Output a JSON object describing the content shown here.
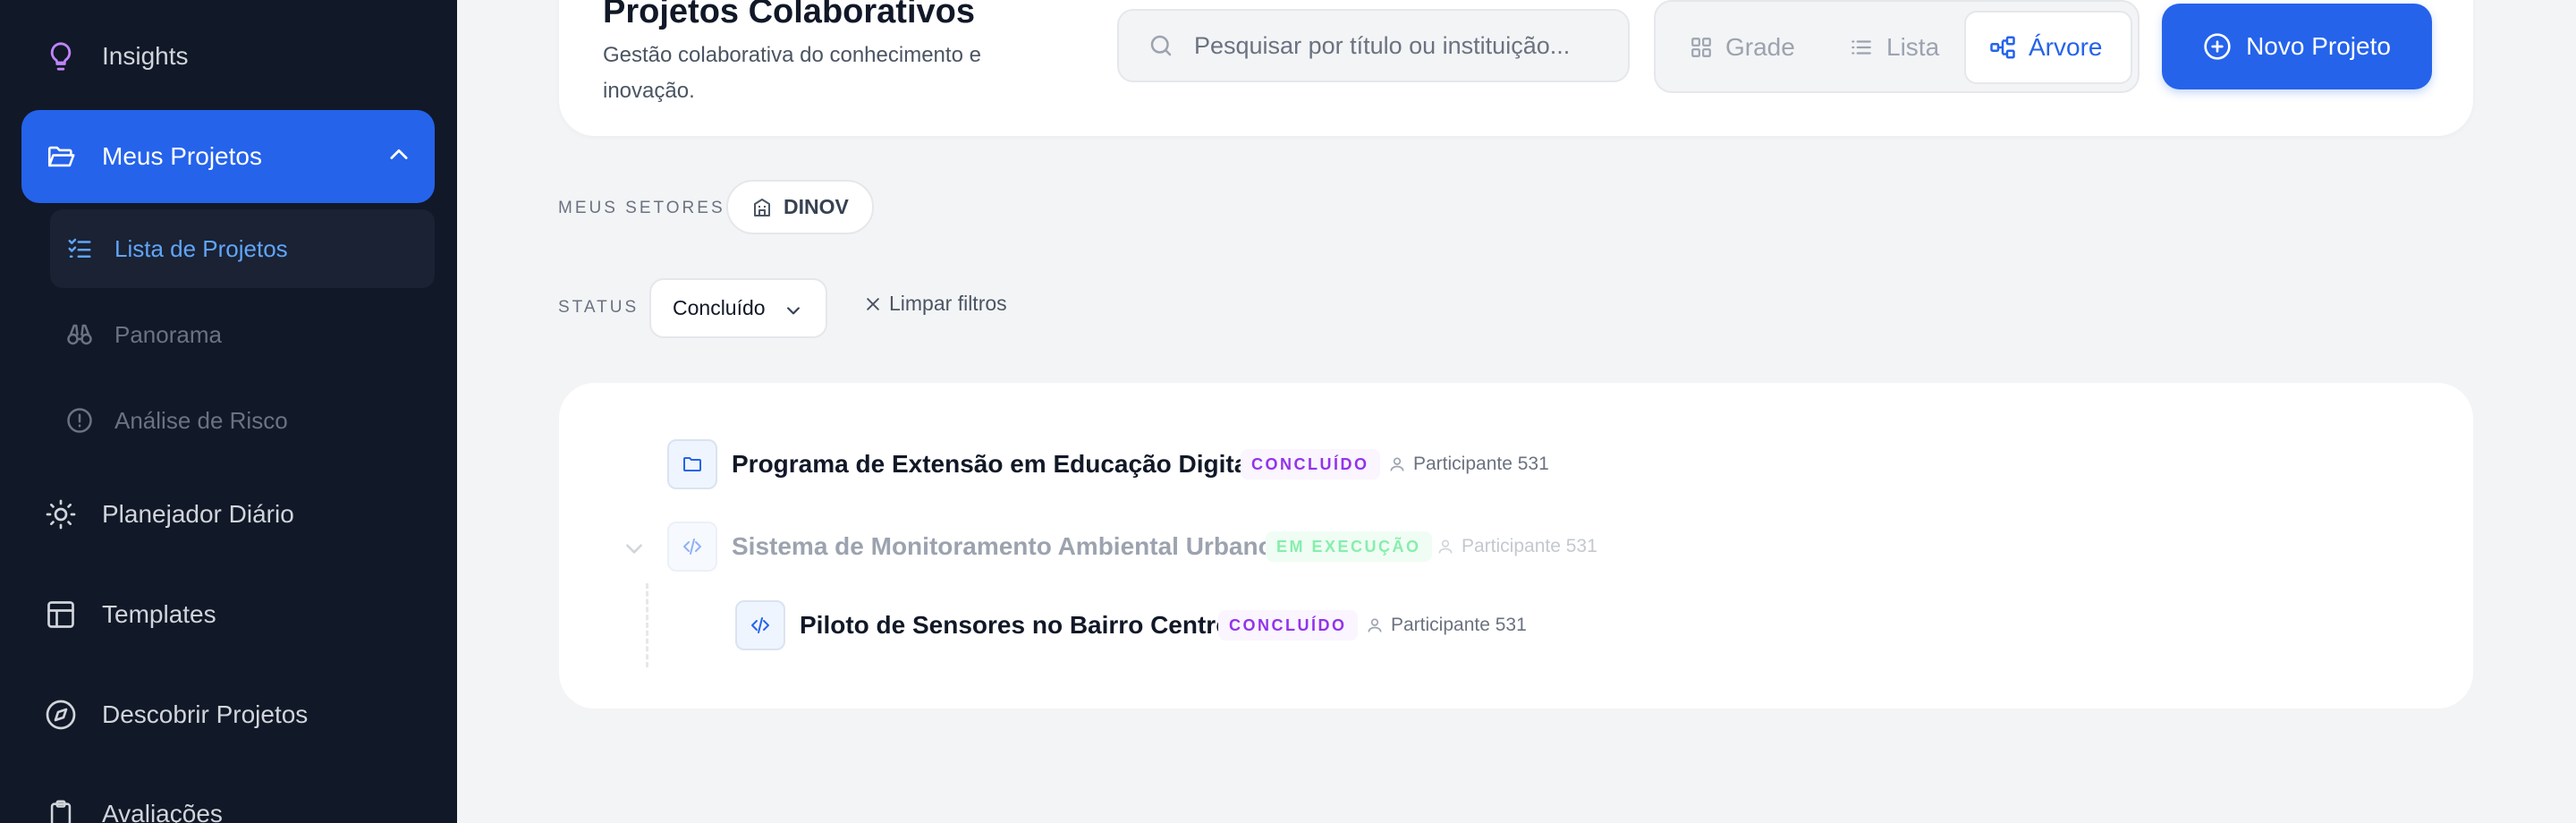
{
  "sidebar": {
    "items": [
      {
        "label": "Insights",
        "icon": "lightbulb-icon"
      },
      {
        "label": "Meus Projetos",
        "icon": "folder-open-icon"
      },
      {
        "label": "Planejador Diário",
        "icon": "sun-icon"
      },
      {
        "label": "Templates",
        "icon": "layout-icon"
      },
      {
        "label": "Descobrir Projetos",
        "icon": "compass-icon"
      },
      {
        "label": "Avaliações",
        "icon": "clipboard-icon"
      }
    ],
    "sub_items": [
      {
        "label": "Lista de Projetos",
        "icon": "list-checks-icon"
      },
      {
        "label": "Panorama",
        "icon": "binoculars-icon"
      },
      {
        "label": "Análise de Risco",
        "icon": "alert-circle-icon"
      }
    ]
  },
  "header": {
    "title": "Projetos Colaborativos",
    "subtitle": "Gestão colaborativa do conhecimento e inovação.",
    "search_placeholder": "Pesquisar por título ou instituição...",
    "views": [
      "Grade",
      "Lista",
      "Árvore"
    ],
    "selected_view": "Árvore",
    "new_button": "Novo Projeto"
  },
  "filters": {
    "sectors_label": "MEUS SETORES",
    "sector_chip": "DINOV",
    "status_label": "STATUS",
    "status_value": "Concluído",
    "clear_label": "Limpar filtros"
  },
  "tree": [
    {
      "title": "Programa de Extensão em Educação Digital",
      "status": "CONCLUÍDO",
      "participant": "Participante 531",
      "icon": "folder-icon"
    },
    {
      "title": "Sistema de Monitoramento Ambiental Urbano",
      "status": "EM EXECUÇÃO",
      "participant": "Participante 531",
      "icon": "code-icon"
    },
    {
      "title": "Piloto de Sensores no Bairro Centro",
      "status": "CONCLUÍDO",
      "participant": "Participante 531",
      "icon": "code-icon"
    }
  ],
  "colors": {
    "sidebar_bg": "#111827",
    "accent": "#2563eb",
    "status_done": "#9333ea",
    "status_running": "#86efac"
  }
}
